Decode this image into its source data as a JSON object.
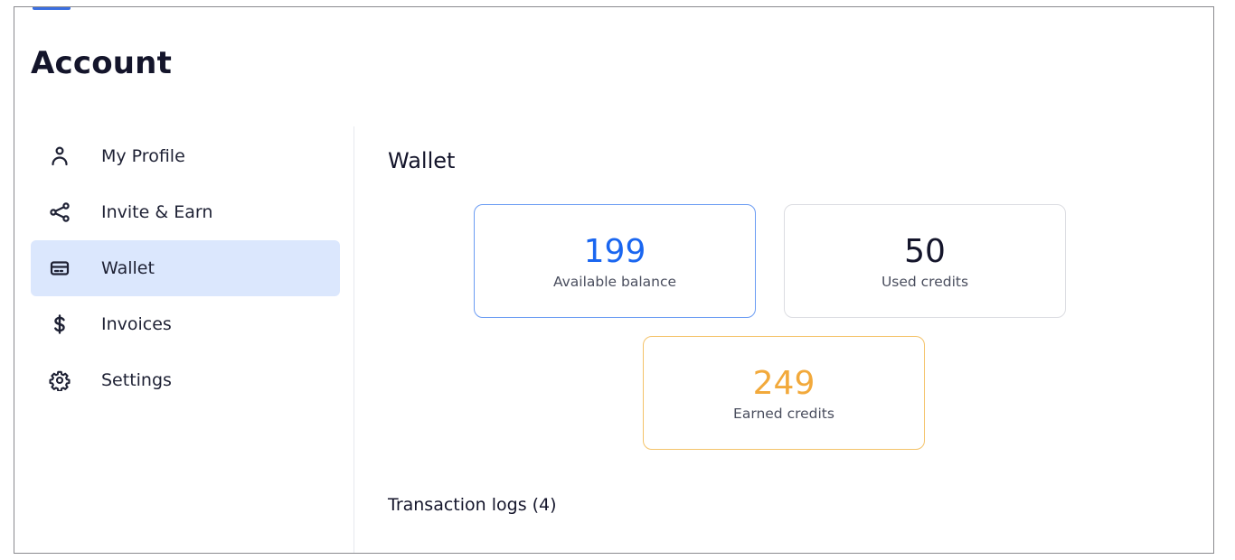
{
  "page": {
    "title": "Account"
  },
  "sidebar": {
    "items": [
      {
        "label": "My Profile",
        "icon": "user-icon",
        "active": false
      },
      {
        "label": "Invite & Earn",
        "icon": "share-icon",
        "active": false
      },
      {
        "label": "Wallet",
        "icon": "credit-card-icon",
        "active": true
      },
      {
        "label": "Invoices",
        "icon": "dollar-icon",
        "active": false
      },
      {
        "label": "Settings",
        "icon": "gear-icon",
        "active": false
      }
    ]
  },
  "main": {
    "section_title": "Wallet",
    "stats": {
      "available": {
        "value": "199",
        "label": "Available balance",
        "color": "#1a66f0"
      },
      "used": {
        "value": "50",
        "label": "Used credits",
        "color": "#14152b"
      },
      "earned": {
        "value": "249",
        "label": "Earned credits",
        "color": "#f2a93b"
      }
    },
    "transactions_title": "Transaction logs (4)"
  },
  "colors": {
    "active_bg": "#dbe7fd",
    "accent_blue": "#1a66f0",
    "accent_orange": "#f2a93b"
  }
}
